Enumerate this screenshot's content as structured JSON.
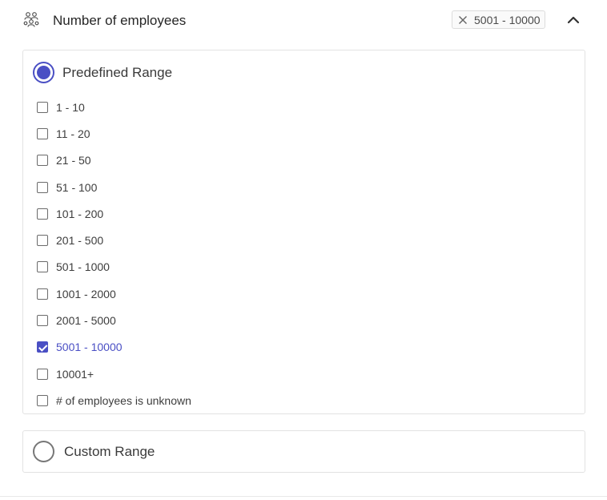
{
  "header": {
    "title": "Number of employees",
    "icon": "people-group-icon",
    "selected_chip": "5001 - 10000"
  },
  "predefined": {
    "label": "Predefined Range",
    "selected": true,
    "options": [
      {
        "label": "1 - 10",
        "checked": false
      },
      {
        "label": "11 - 20",
        "checked": false
      },
      {
        "label": "21 - 50",
        "checked": false
      },
      {
        "label": "51 - 100",
        "checked": false
      },
      {
        "label": "101 - 200",
        "checked": false
      },
      {
        "label": "201 - 500",
        "checked": false
      },
      {
        "label": "501 - 1000",
        "checked": false
      },
      {
        "label": "1001 - 2000",
        "checked": false
      },
      {
        "label": "2001 - 5000",
        "checked": false
      },
      {
        "label": "5001 - 10000",
        "checked": true
      },
      {
        "label": "10001+",
        "checked": false
      },
      {
        "label": "# of employees is unknown",
        "checked": false
      }
    ]
  },
  "custom": {
    "label": "Custom Range",
    "selected": false
  },
  "colors": {
    "accent": "#4a4fc4",
    "border": "#e2e2e2",
    "text": "#3d3d3d"
  }
}
